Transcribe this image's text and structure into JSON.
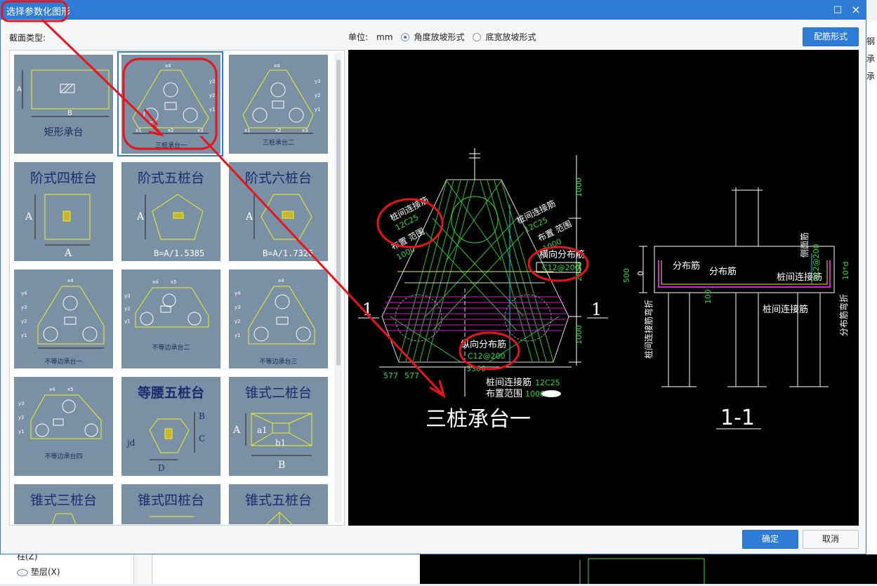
{
  "dialog": {
    "title": "选择参数化图形",
    "section_label": "截面类型:",
    "unit_label": "单位:",
    "unit_value": "mm",
    "radio_angle": "角度放坡形式",
    "radio_bottom": "底宽放坡形式",
    "rebar_button": "配筋形式",
    "ok_button": "确定",
    "cancel_button": "取消",
    "maximize_icon": "□",
    "close_icon": "×"
  },
  "tiles": [
    {
      "caption": "矩形承台",
      "dims": [
        "A",
        "B"
      ]
    },
    {
      "caption": "三桩承台一",
      "dims": [
        "x4",
        "y1",
        "y2",
        "y3",
        "x1",
        "x2",
        "x3"
      ]
    },
    {
      "caption": "三桩承台二",
      "dims": [
        "x4",
        "y1",
        "y2",
        "y3",
        "x1",
        "x2",
        "x3"
      ]
    },
    {
      "caption": "阶式四桩台",
      "dims": [
        "A",
        "A"
      ]
    },
    {
      "caption": "阶式五桩台",
      "dims": [
        "A",
        "B=A/1.5385"
      ]
    },
    {
      "caption": "阶式六桩台",
      "dims": [
        "A",
        "B=A/1.7326"
      ]
    },
    {
      "caption": "不等边承台一",
      "dims": [
        "x4",
        "y1",
        "y2",
        "y3",
        "y4"
      ]
    },
    {
      "caption": "不等边承台二",
      "dims": [
        "x4",
        "x5",
        "y1",
        "y2",
        "y3"
      ]
    },
    {
      "caption": "不等边承台三",
      "dims": [
        "x4",
        "y1",
        "y2",
        "y3",
        "y4"
      ]
    },
    {
      "caption": "不等边承台四",
      "dims": [
        "x4",
        "x5",
        "y1",
        "y2",
        "y3"
      ]
    },
    {
      "caption": "等腰五桩台",
      "dims": [
        "B",
        "C",
        "D",
        "jd"
      ]
    },
    {
      "caption": "锥式二桩台",
      "dims": [
        "A",
        "a1",
        "b1",
        "B"
      ]
    },
    {
      "caption": "锥式三桩台",
      "dims": []
    },
    {
      "caption": "锥式四桩台",
      "dims": []
    },
    {
      "caption": "锥式五桩台",
      "dims": []
    }
  ],
  "preview": {
    "plan_title": "三桩承台一",
    "section_title": "1-1",
    "section_mark": "1",
    "labels": {
      "pile_link_left": "桩间连接筋",
      "pile_link_left_value": "12C25",
      "layout_range_left": "布置 范围",
      "layout_range_left_value": "1000",
      "pile_link_right": "桩间连接筋",
      "pile_link_right_value": "12C25",
      "layout_range_right": "布置 范围",
      "layout_range_right_value": "1000",
      "transverse_dist": "横向分布筋",
      "transverse_dist_value": "C12@200",
      "longitudinal_dist": "纵向分布筋",
      "longitudinal_dist_value": "C12@200",
      "bottom_link": "桩间连接筋",
      "bottom_link_value": "12C25",
      "bottom_range": "布置范围",
      "bottom_range_value": "1000",
      "dim_1000_top": "1000",
      "dim_2856": "2856",
      "dim_1000_bottom": "1000",
      "dim_577a": "577",
      "dim_577b": "577",
      "dim_3300": "3300",
      "sec_dist1": "分布筋",
      "sec_dist2": "分布筋",
      "sec_side": "侧面筋",
      "sec_side_value": "C12@200",
      "sec_link": "桩间连接筋",
      "sec_link_bottom": "桩间连接筋",
      "sec_link_bend": "桩间连接筋弯折",
      "sec_dist_bend": "分布筋弯折",
      "sec_10d": "10*d",
      "sec_500": "500",
      "sec_0": "0",
      "sec_100": "100"
    }
  },
  "background": {
    "tree_item1": "柱(Z)",
    "tree_item2": "垫层(X)",
    "right_chars": [
      "钢",
      "承",
      "承"
    ]
  },
  "colors": {
    "title_bar": "#2e7cd6",
    "tile_bg": "#7a90a4",
    "annotation_red": "#e8141b",
    "cad_green": "#33d633",
    "cad_yellow": "#f0f028",
    "cad_magenta": "#d020d0",
    "cad_cyan": "#20c8e0"
  }
}
